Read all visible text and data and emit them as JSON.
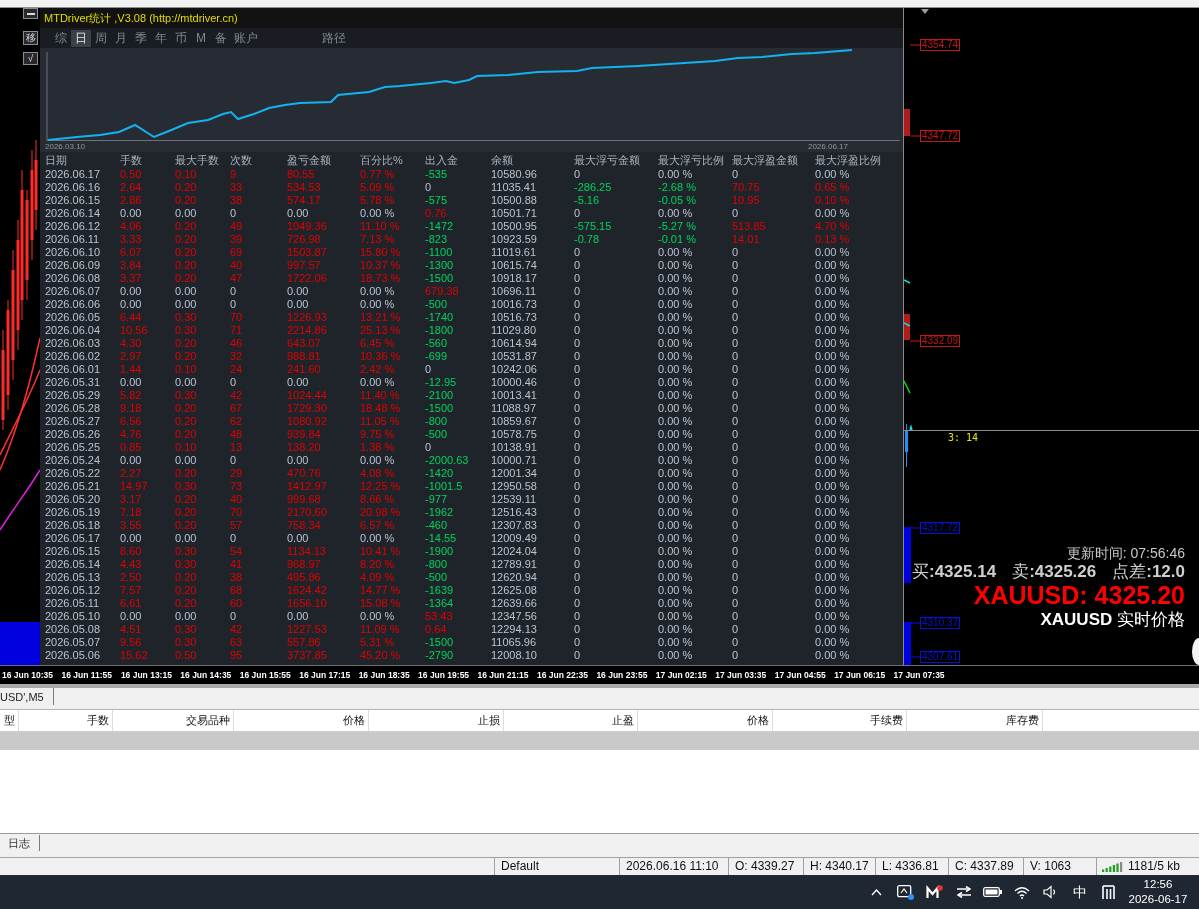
{
  "chart_controls": [
    {
      "kind": "minimize"
    },
    {
      "kind": "text",
      "label": "移"
    },
    {
      "kind": "text",
      "label": "√"
    }
  ],
  "stats_panel": {
    "title": "MTDriver统计 ,V3.08 (http://mtdriver.cn)",
    "tabs": [
      {
        "label": "综",
        "selected": false
      },
      {
        "label": "日",
        "selected": true
      },
      {
        "label": "周",
        "selected": false
      },
      {
        "label": "月",
        "selected": false
      },
      {
        "label": "季",
        "selected": false
      },
      {
        "label": "年",
        "selected": false
      },
      {
        "label": "币",
        "selected": false
      },
      {
        "label": "M",
        "selected": false
      },
      {
        "label": "备",
        "selected": false
      },
      {
        "label": "账户",
        "selected": false
      }
    ],
    "path_button": "路径",
    "equity_chart": {
      "start_label": "2026.03.10",
      "end_label": "2026.06.17"
    },
    "table": {
      "columns": [
        {
          "label": "日期",
          "kind": "plain"
        },
        {
          "label": "手数",
          "kind": "signed"
        },
        {
          "label": "最大手数",
          "kind": "signed"
        },
        {
          "label": "次数",
          "kind": "signed"
        },
        {
          "label": "盈亏金额",
          "kind": "signed"
        },
        {
          "label": "百分比%",
          "kind": "signed"
        },
        {
          "label": "出入金",
          "kind": "signed"
        },
        {
          "label": "余额",
          "kind": "plain"
        },
        {
          "label": "最大浮亏金额",
          "kind": "signed"
        },
        {
          "label": "最大浮亏比例",
          "kind": "signed"
        },
        {
          "label": "最大浮盈金额",
          "kind": "signed"
        },
        {
          "label": "最大浮盈比例",
          "kind": "signed"
        }
      ],
      "rows": [
        [
          "2026.06.17",
          "0.50",
          "0.10",
          "9",
          "80.55",
          "0.77 %",
          "-535",
          "10580.96",
          "0",
          "0.00 %",
          "0",
          "0.00 %"
        ],
        [
          "2026.06.16",
          "2.64",
          "0.20",
          "33",
          "534.53",
          "5.09 %",
          "0",
          "11035.41",
          "-286.25",
          "-2.68 %",
          "70.75",
          "0.65 %"
        ],
        [
          "2026.06.15",
          "2.86",
          "0.20",
          "38",
          "574.17",
          "5.78 %",
          "-575",
          "10500.88",
          "-5.16",
          "-0.05 %",
          "10.95",
          "0.10 %"
        ],
        [
          "2026.06.14",
          "0.00",
          "0.00",
          "0",
          "0.00",
          "0.00 %",
          "0.76",
          "10501.71",
          "0",
          "0.00 %",
          "0",
          "0.00 %"
        ],
        [
          "2026.06.12",
          "4.06",
          "0.20",
          "49",
          "1049.36",
          "11.10 %",
          "-1472",
          "10500.95",
          "-575.15",
          "-5.27 %",
          "513.85",
          "4.70 %"
        ],
        [
          "2026.06.11",
          "3.33",
          "0.20",
          "39",
          "726.98",
          "7.13 %",
          "-823",
          "10923.59",
          "-0.78",
          "-0.01 %",
          "14.01",
          "0.13 %"
        ],
        [
          "2026.06.10",
          "6.07",
          "0.20",
          "69",
          "1503.87",
          "15.80 %",
          "-1100",
          "11019.61",
          "0",
          "0.00 %",
          "0",
          "0.00 %"
        ],
        [
          "2026.06.09",
          "3.84",
          "0.20",
          "40",
          "997.57",
          "10.37 %",
          "-1300",
          "10615.74",
          "0",
          "0.00 %",
          "0",
          "0.00 %"
        ],
        [
          "2026.06.08",
          "3.37",
          "0.20",
          "47",
          "1722.06",
          "18.73 %",
          "-1500",
          "10918.17",
          "0",
          "0.00 %",
          "0",
          "0.00 %"
        ],
        [
          "2026.06.07",
          "0.00",
          "0.00",
          "0",
          "0.00",
          "0.00 %",
          "679.38",
          "10696.11",
          "0",
          "0.00 %",
          "0",
          "0.00 %"
        ],
        [
          "2026.06.06",
          "0.00",
          "0.00",
          "0",
          "0.00",
          "0.00 %",
          "-500",
          "10016.73",
          "0",
          "0.00 %",
          "0",
          "0.00 %"
        ],
        [
          "2026.06.05",
          "6.44",
          "0.30",
          "70",
          "1226.93",
          "13.21 %",
          "-1740",
          "10516.73",
          "0",
          "0.00 %",
          "0",
          "0.00 %"
        ],
        [
          "2026.06.04",
          "10.56",
          "0.30",
          "71",
          "2214.86",
          "25.13 %",
          "-1800",
          "11029.80",
          "0",
          "0.00 %",
          "0",
          "0.00 %"
        ],
        [
          "2026.06.03",
          "4.30",
          "0.20",
          "46",
          "643.07",
          "6.45 %",
          "-560",
          "10614.94",
          "0",
          "0.00 %",
          "0",
          "0.00 %"
        ],
        [
          "2026.06.02",
          "2.97",
          "0.20",
          "32",
          "988.81",
          "10.36 %",
          "-699",
          "10531.87",
          "0",
          "0.00 %",
          "0",
          "0.00 %"
        ],
        [
          "2026.06.01",
          "1.44",
          "0.10",
          "24",
          "241.60",
          "2.42 %",
          "0",
          "10242.06",
          "0",
          "0.00 %",
          "0",
          "0.00 %"
        ],
        [
          "2026.05.31",
          "0.00",
          "0.00",
          "0",
          "0.00",
          "0.00 %",
          "-12.95",
          "10000.46",
          "0",
          "0.00 %",
          "0",
          "0.00 %"
        ],
        [
          "2026.05.29",
          "5.82",
          "0.30",
          "42",
          "1024.44",
          "11.40 %",
          "-2100",
          "10013.41",
          "0",
          "0.00 %",
          "0",
          "0.00 %"
        ],
        [
          "2026.05.28",
          "9.18",
          "0.20",
          "67",
          "1729.30",
          "18.48 %",
          "-1500",
          "11088.97",
          "0",
          "0.00 %",
          "0",
          "0.00 %"
        ],
        [
          "2026.05.27",
          "6.56",
          "0.20",
          "62",
          "1080.92",
          "11.05 %",
          "-800",
          "10859.67",
          "0",
          "0.00 %",
          "0",
          "0.00 %"
        ],
        [
          "2026.05.26",
          "4.76",
          "0.20",
          "48",
          "939.84",
          "9.75 %",
          "-500",
          "10578.75",
          "0",
          "0.00 %",
          "0",
          "0.00 %"
        ],
        [
          "2026.05.25",
          "0.85",
          "0.10",
          "13",
          "138.20",
          "1.38 %",
          "0",
          "10138.91",
          "0",
          "0.00 %",
          "0",
          "0.00 %"
        ],
        [
          "2026.05.24",
          "0.00",
          "0.00",
          "0",
          "0.00",
          "0.00 %",
          "-2000.63",
          "10000.71",
          "0",
          "0.00 %",
          "0",
          "0.00 %"
        ],
        [
          "2026.05.22",
          "2.27",
          "0.20",
          "29",
          "470.76",
          "4.08 %",
          "-1420",
          "12001.34",
          "0",
          "0.00 %",
          "0",
          "0.00 %"
        ],
        [
          "2026.05.21",
          "14.97",
          "0.30",
          "73",
          "1412.97",
          "12.25 %",
          "-1001.5",
          "12950.58",
          "0",
          "0.00 %",
          "0",
          "0.00 %"
        ],
        [
          "2026.05.20",
          "3.17",
          "0.20",
          "40",
          "999.68",
          "8.66 %",
          "-977",
          "12539.11",
          "0",
          "0.00 %",
          "0",
          "0.00 %"
        ],
        [
          "2026.05.19",
          "7.18",
          "0.20",
          "70",
          "2170.60",
          "20.98 %",
          "-1962",
          "12516.43",
          "0",
          "0.00 %",
          "0",
          "0.00 %"
        ],
        [
          "2026.05.18",
          "3.55",
          "0.20",
          "57",
          "758.34",
          "6.57 %",
          "-460",
          "12307.83",
          "0",
          "0.00 %",
          "0",
          "0.00 %"
        ],
        [
          "2026.05.17",
          "0.00",
          "0.00",
          "0",
          "0.00",
          "0.00 %",
          "-14.55",
          "12009.49",
          "0",
          "0.00 %",
          "0",
          "0.00 %"
        ],
        [
          "2026.05.15",
          "8.60",
          "0.30",
          "54",
          "1134.13",
          "10.41 %",
          "-1900",
          "12024.04",
          "0",
          "0.00 %",
          "0",
          "0.00 %"
        ],
        [
          "2026.05.14",
          "4.43",
          "0.30",
          "41",
          "968.97",
          "8.20 %",
          "-800",
          "12789.91",
          "0",
          "0.00 %",
          "0",
          "0.00 %"
        ],
        [
          "2026.05.13",
          "2.50",
          "0.20",
          "38",
          "495.86",
          "4.09 %",
          "-500",
          "12620.94",
          "0",
          "0.00 %",
          "0",
          "0.00 %"
        ],
        [
          "2026.05.12",
          "7.57",
          "0.20",
          "68",
          "1624.42",
          "14.77 %",
          "-1639",
          "12625.08",
          "0",
          "0.00 %",
          "0",
          "0.00 %"
        ],
        [
          "2026.05.11",
          "6.61",
          "0.20",
          "60",
          "1656.10",
          "15.08 %",
          "-1364",
          "12639.66",
          "0",
          "0.00 %",
          "0",
          "0.00 %"
        ],
        [
          "2026.05.10",
          "0.00",
          "0.00",
          "0",
          "0.00",
          "0.00 %",
          "53.43",
          "12347.56",
          "0",
          "0.00 %",
          "0",
          "0.00 %"
        ],
        [
          "2026.05.08",
          "4.51",
          "0.30",
          "42",
          "1227.53",
          "11.09 %",
          "0.64",
          "12294.13",
          "0",
          "0.00 %",
          "0",
          "0.00 %"
        ],
        [
          "2026.05.07",
          "9.56",
          "0.30",
          "63",
          "557.86",
          "5.31 %",
          "-1500",
          "11065.96",
          "0",
          "0.00 %",
          "0",
          "0.00 %"
        ],
        [
          "2026.05.06",
          "15.62",
          "0.50",
          "95",
          "3737.85",
          "45.20 %",
          "-2790",
          "12008.10",
          "0",
          "0.00 %",
          "0",
          "0.00 %"
        ]
      ]
    }
  },
  "price_labels": [
    {
      "text": "4354.74",
      "color": "#c0161e"
    },
    {
      "text": "4347.72",
      "color": "#c0161e"
    },
    {
      "text": "4332.09",
      "color": "#c0161e"
    },
    {
      "text": "4317.72",
      "color": "#0a10d0"
    },
    {
      "text": "4310.37",
      "color": "#0a10d0"
    },
    {
      "text": "4307.61",
      "color": "#0a10d0"
    }
  ],
  "bar_timer": "3: 14",
  "quote_panel": {
    "update_time": "更新时间: 07:56:46",
    "quotes": [
      "买**:4325.14**",
      "卖**:4325.26**",
      "点差**:12.0**"
    ],
    "symbol_price": "XAUUSD: 4325.20",
    "caption": "**XAUUSD** 实时价格"
  },
  "time_axis": [
    "16 Jun 10:35",
    "16 Jun 11:55",
    "16 Jun 13:15",
    "16 Jun 14:35",
    "16 Jun 15:55",
    "16 Jun 17:15",
    "16 Jun 18:35",
    "16 Jun 19:55",
    "16 Jun 21:15",
    "16 Jun 22:35",
    "16 Jun 23:55",
    "17 Jun 02:15",
    "17 Jun 03:35",
    "17 Jun 04:55",
    "17 Jun 06:15",
    "17 Jun 07:35"
  ],
  "terminal": {
    "chart_tab": "USD',M5",
    "columns": [
      "型",
      "手数",
      "交易品种",
      "价格",
      "止损",
      "止盈",
      "价格",
      "手续费",
      "库存费"
    ],
    "log_tab": "日志"
  },
  "status_bar": {
    "items": [
      "Default",
      "2026.06.16 11:10",
      "O: 4339.27",
      "H: 4340.17",
      "L: 4336.81",
      "C: 4337.89",
      "V: 1063"
    ],
    "traffic": "1181/5 kb"
  },
  "taskbar": {
    "ime_mode": "中",
    "time": "12:56",
    "date": "2026-06-17"
  }
}
